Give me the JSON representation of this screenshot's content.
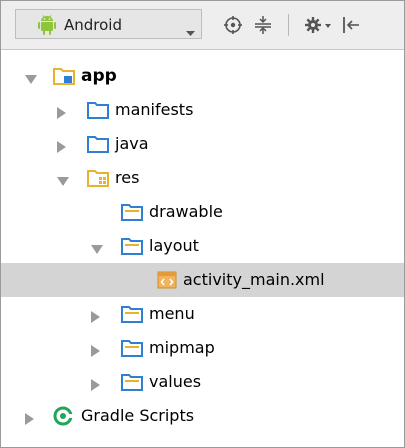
{
  "toolbar": {
    "view_selector": "Android"
  },
  "colors": {
    "android_green": "#8fc43d",
    "folder_blue": "#2f7fd3",
    "res_yellow": "#e8b12e",
    "selection_gray": "#d4d4d4",
    "gradle_green": "#1fa65a"
  },
  "tree": {
    "app": "app",
    "manifests": "manifests",
    "java": "java",
    "res": "res",
    "drawable": "drawable",
    "layout": "layout",
    "activity_main": "activity_main.xml",
    "menu": "menu",
    "mipmap": "mipmap",
    "values": "values",
    "gradle": "Gradle Scripts"
  }
}
